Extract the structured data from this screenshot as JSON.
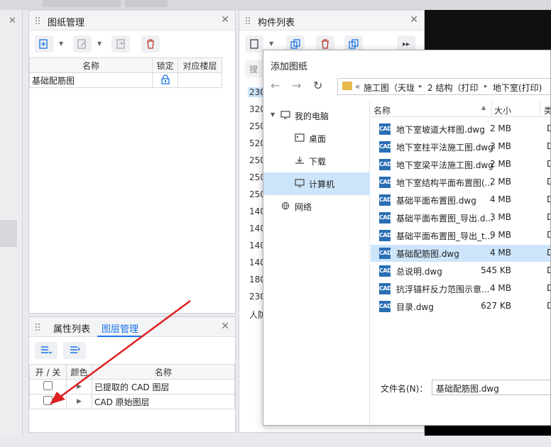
{
  "drawing_panel": {
    "title": "图纸管理",
    "columns": [
      "名称",
      "锁定",
      "对应楼层"
    ],
    "rows": [
      {
        "name": "基础配筋图",
        "locked": true,
        "floor": ""
      }
    ]
  },
  "layer_panel": {
    "tabs": [
      "属性列表",
      "图层管理"
    ],
    "active_tab": "图层管理",
    "columns": [
      "开 / 关",
      "颜色",
      "名称"
    ],
    "rows": [
      {
        "name": "已提取的 CAD 图层",
        "checked": false
      },
      {
        "name": "CAD 原始图层",
        "checked": false
      }
    ]
  },
  "component_panel": {
    "title": "构件列表",
    "search_placeholder": "搜",
    "items": [
      "230",
      "320",
      "250",
      "520",
      "250",
      "250",
      "250",
      "140",
      "140",
      "140",
      "140",
      "180",
      "230",
      "人防"
    ]
  },
  "dialog": {
    "title": "添加图纸",
    "breadcrumb": [
      "«",
      "施工图（天珑",
      "2 结构（打印",
      "地下室(打印)"
    ],
    "tree": [
      {
        "label": "我的电脑",
        "icon": "monitor-icon"
      },
      {
        "label": "桌面",
        "icon": "desktop-icon"
      },
      {
        "label": "下载",
        "icon": "download-icon"
      },
      {
        "label": "计算机",
        "icon": "computer-icon",
        "selected": true
      },
      {
        "label": "网络",
        "icon": "network-icon"
      }
    ],
    "list_columns": [
      "名称",
      "大小",
      "类"
    ],
    "files": [
      {
        "name": "地下室坡道大样图.dwg",
        "size": "2 MB",
        "type": "D"
      },
      {
        "name": "地下室柱平法施工图.dwg",
        "size": "3 MB",
        "type": "D"
      },
      {
        "name": "地下室梁平法施工图.dwg",
        "size": "2 MB",
        "type": "D"
      },
      {
        "name": "地下室结构平面布置图(...",
        "size": "2 MB",
        "type": "D"
      },
      {
        "name": "基础平面布置图.dwg",
        "size": "4 MB",
        "type": "D"
      },
      {
        "name": "基础平面布置图_导出.d...",
        "size": "3 MB",
        "type": "D"
      },
      {
        "name": "基础平面布置图_导出_t...",
        "size": "9 MB",
        "type": "D"
      },
      {
        "name": "基础配筋图.dwg",
        "size": "4 MB",
        "type": "D",
        "selected": true
      },
      {
        "name": "总说明.dwg",
        "size": "545 KB",
        "type": "D"
      },
      {
        "name": "抗浮锚杆反力范围示意...",
        "size": "4 MB",
        "type": "D"
      },
      {
        "name": "目录.dwg",
        "size": "627 KB",
        "type": "D"
      }
    ],
    "filename_label": "文件名(N)：",
    "filename_value": "基础配筋图.dwg",
    "cad_label": "CAD"
  },
  "colors": {
    "accent": "#1a73e8",
    "selection": "#cde5fb",
    "cad_icon": "#2a6fb5",
    "arrow": "#e02020"
  }
}
